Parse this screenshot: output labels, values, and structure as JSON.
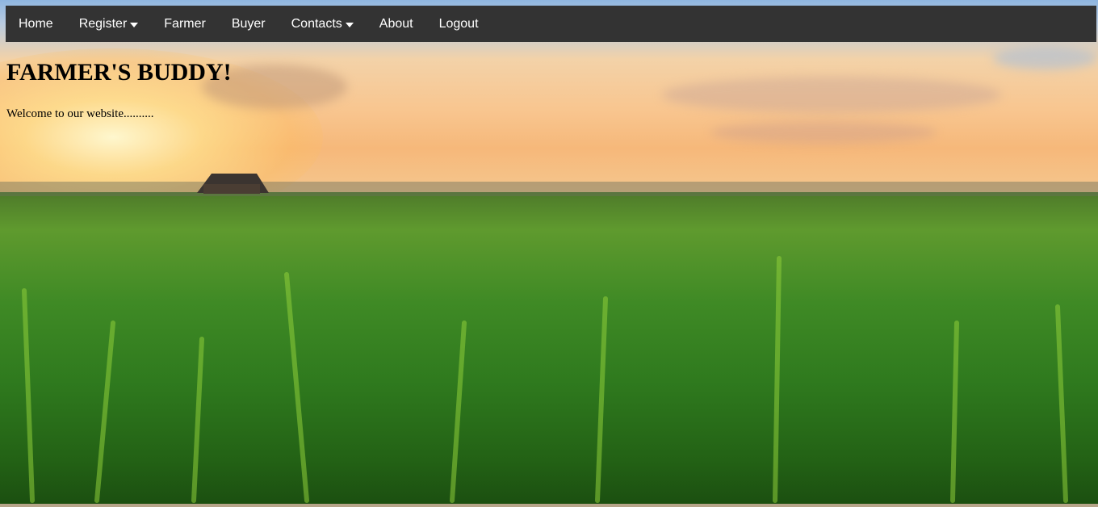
{
  "nav": {
    "items": [
      {
        "label": "Home",
        "dropdown": false
      },
      {
        "label": "Register",
        "dropdown": true
      },
      {
        "label": "Farmer",
        "dropdown": false
      },
      {
        "label": "Buyer",
        "dropdown": false
      },
      {
        "label": "Contacts",
        "dropdown": true
      },
      {
        "label": "About",
        "dropdown": false
      },
      {
        "label": "Logout",
        "dropdown": false
      }
    ]
  },
  "hero": {
    "title": "FARMER'S BUDDY!",
    "welcome": "Welcome to our website.........."
  },
  "colors": {
    "navbar_bg": "#333333",
    "nav_text": "#ffffff",
    "heading_text": "#000000"
  }
}
